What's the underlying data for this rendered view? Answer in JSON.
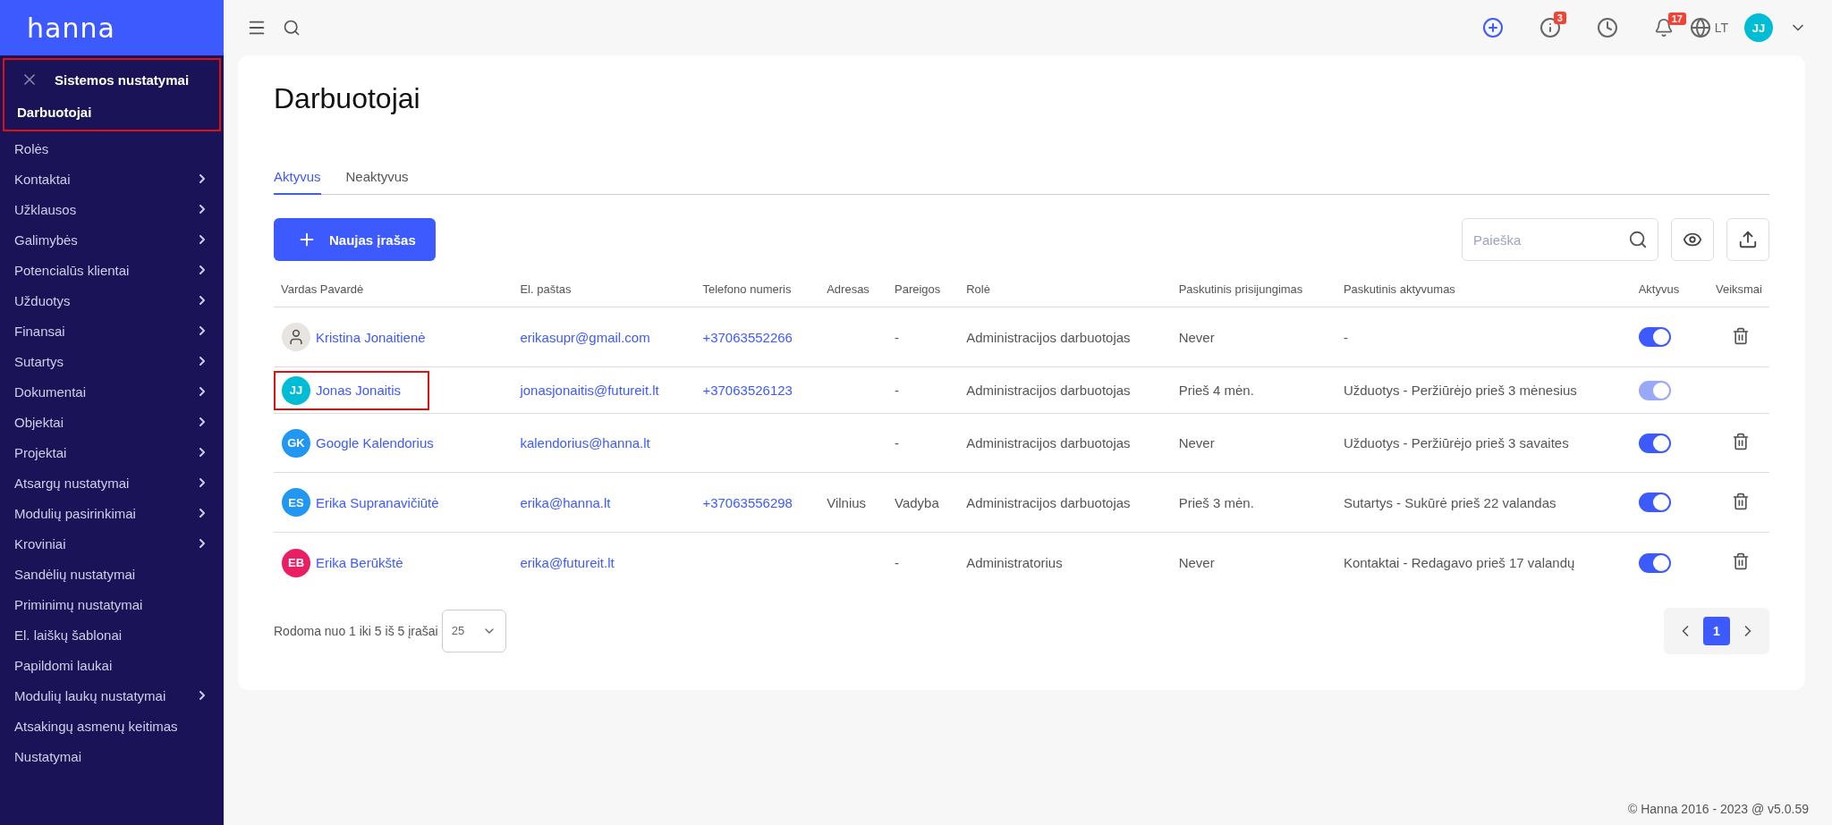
{
  "sidebar": {
    "logo": "hanna",
    "section": {
      "title": "Sistemos nustatymai",
      "highlighted": true
    },
    "items": [
      {
        "label": "Darbuotojai",
        "selected": true,
        "has_children": false
      },
      {
        "label": "Rolės",
        "selected": false,
        "has_children": false
      },
      {
        "label": "Kontaktai",
        "selected": false,
        "has_children": true
      },
      {
        "label": "Užklausos",
        "selected": false,
        "has_children": true
      },
      {
        "label": "Galimybės",
        "selected": false,
        "has_children": true
      },
      {
        "label": "Potencialūs klientai",
        "selected": false,
        "has_children": true
      },
      {
        "label": "Užduotys",
        "selected": false,
        "has_children": true
      },
      {
        "label": "Finansai",
        "selected": false,
        "has_children": true
      },
      {
        "label": "Sutartys",
        "selected": false,
        "has_children": true
      },
      {
        "label": "Dokumentai",
        "selected": false,
        "has_children": true
      },
      {
        "label": "Objektai",
        "selected": false,
        "has_children": true
      },
      {
        "label": "Projektai",
        "selected": false,
        "has_children": true
      },
      {
        "label": "Atsargų nustatymai",
        "selected": false,
        "has_children": true
      },
      {
        "label": "Modulių pasirinkimai",
        "selected": false,
        "has_children": true
      },
      {
        "label": "Kroviniai",
        "selected": false,
        "has_children": true
      },
      {
        "label": "Sandėlių nustatymai",
        "selected": false,
        "has_children": false
      },
      {
        "label": "Priminimų nustatymai",
        "selected": false,
        "has_children": false
      },
      {
        "label": "El. laiškų šablonai",
        "selected": false,
        "has_children": false
      },
      {
        "label": "Papildomi laukai",
        "selected": false,
        "has_children": false
      },
      {
        "label": "Modulių laukų nustatymai",
        "selected": false,
        "has_children": true
      },
      {
        "label": "Atsakingų asmenų keitimas",
        "selected": false,
        "has_children": false
      },
      {
        "label": "Nustatymai",
        "selected": false,
        "has_children": false
      }
    ]
  },
  "topbar": {
    "info_badge": "3",
    "notifications_badge": "17",
    "language": "LT",
    "user_initials": "JJ"
  },
  "page": {
    "title": "Darbuotojai",
    "tabs": [
      {
        "label": "Aktyvus",
        "selected": true
      },
      {
        "label": "Neaktyvus",
        "selected": false
      }
    ],
    "new_button": "Naujas įrašas",
    "search": {
      "placeholder": "Paieška"
    },
    "table": {
      "columns": [
        "Vardas Pavardė",
        "El. paštas",
        "Telefono numeris",
        "Adresas",
        "Pareigos",
        "Rolė",
        "Paskutinis prisijungimas",
        "Paskutinis aktyvumas",
        "Aktyvus",
        "Veiksmai"
      ],
      "rows": [
        {
          "avatar": {
            "kind": "photo"
          },
          "name": "Kristina Jonaitienė",
          "highlighted": false,
          "email": "erikasupr@gmail.com",
          "phone": "+37063552266",
          "address": "",
          "position": "-",
          "role": "Administracijos darbuotojas",
          "last_login": "Never",
          "last_activity": "-",
          "active": true,
          "disabled": false,
          "deletable": true
        },
        {
          "avatar": {
            "kind": "initials",
            "initials": "JJ",
            "color": "#00bcd4"
          },
          "name": "Jonas Jonaitis",
          "highlighted": true,
          "email": "jonasjonaitis@futureit.lt",
          "phone": "+37063526123",
          "address": "",
          "position": "-",
          "role": "Administracijos darbuotojas",
          "last_login": "Prieš 4 mėn.",
          "last_activity": "Užduotys - Peržiūrėjo prieš 3 mėnesius",
          "active": true,
          "disabled": true,
          "deletable": false
        },
        {
          "avatar": {
            "kind": "initials",
            "initials": "GK",
            "color": "#2196f3"
          },
          "name": "Google Kalendorius",
          "highlighted": false,
          "email": "kalendorius@hanna.lt",
          "phone": "",
          "address": "",
          "position": "-",
          "role": "Administracijos darbuotojas",
          "last_login": "Never",
          "last_activity": "Užduotys - Peržiūrėjo prieš 3 savaites",
          "active": true,
          "disabled": false,
          "deletable": true
        },
        {
          "avatar": {
            "kind": "initials",
            "initials": "ES",
            "color": "#2196f3"
          },
          "name": "Erika Supranavičiūtė",
          "highlighted": false,
          "email": "erika@hanna.lt",
          "phone": "+37063556298",
          "address": "Vilnius",
          "position": "Vadyba",
          "role": "Administracijos darbuotojas",
          "last_login": "Prieš 3 mėn.",
          "last_activity": "Sutartys - Sukūrė prieš 22 valandas",
          "active": true,
          "disabled": false,
          "deletable": true
        },
        {
          "avatar": {
            "kind": "initials",
            "initials": "EB",
            "color": "#e91e63"
          },
          "name": "Erika Berūkštė",
          "highlighted": false,
          "email": "erika@futureit.lt",
          "phone": "",
          "address": "",
          "position": "-",
          "role": "Administratorius",
          "last_login": "Never",
          "last_activity": "Kontaktai - Redagavo prieš 17 valandų",
          "active": true,
          "disabled": false,
          "deletable": true
        }
      ]
    },
    "summary": "Rodoma nuo 1 iki 5 iš 5 įrašai",
    "page_size": "25",
    "pages": [
      {
        "label": "1",
        "selected": true
      }
    ]
  },
  "footer": "© Hanna 2016 - 2023 @ v5.0.59"
}
